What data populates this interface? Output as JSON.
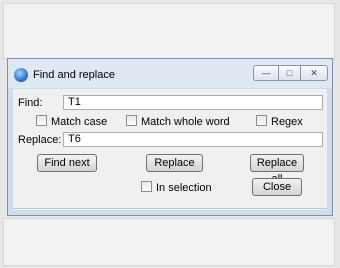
{
  "window": {
    "title": "Find and replace",
    "controls": {
      "minimize": "—",
      "maximize": "□",
      "close": "✕"
    }
  },
  "find": {
    "label": "Find:",
    "value": "T1"
  },
  "options": {
    "match_case": {
      "label": "Match case",
      "checked": false
    },
    "match_whole_word": {
      "label": "Match whole word",
      "checked": false
    },
    "regex": {
      "label": "Regex",
      "checked": false
    },
    "in_selection": {
      "label": "In selection",
      "checked": false
    }
  },
  "replace": {
    "label": "Replace:",
    "value": "T6"
  },
  "buttons": {
    "find_next": "Find next",
    "replace": "Replace",
    "replace_all": "Replace all",
    "close": "Close"
  }
}
